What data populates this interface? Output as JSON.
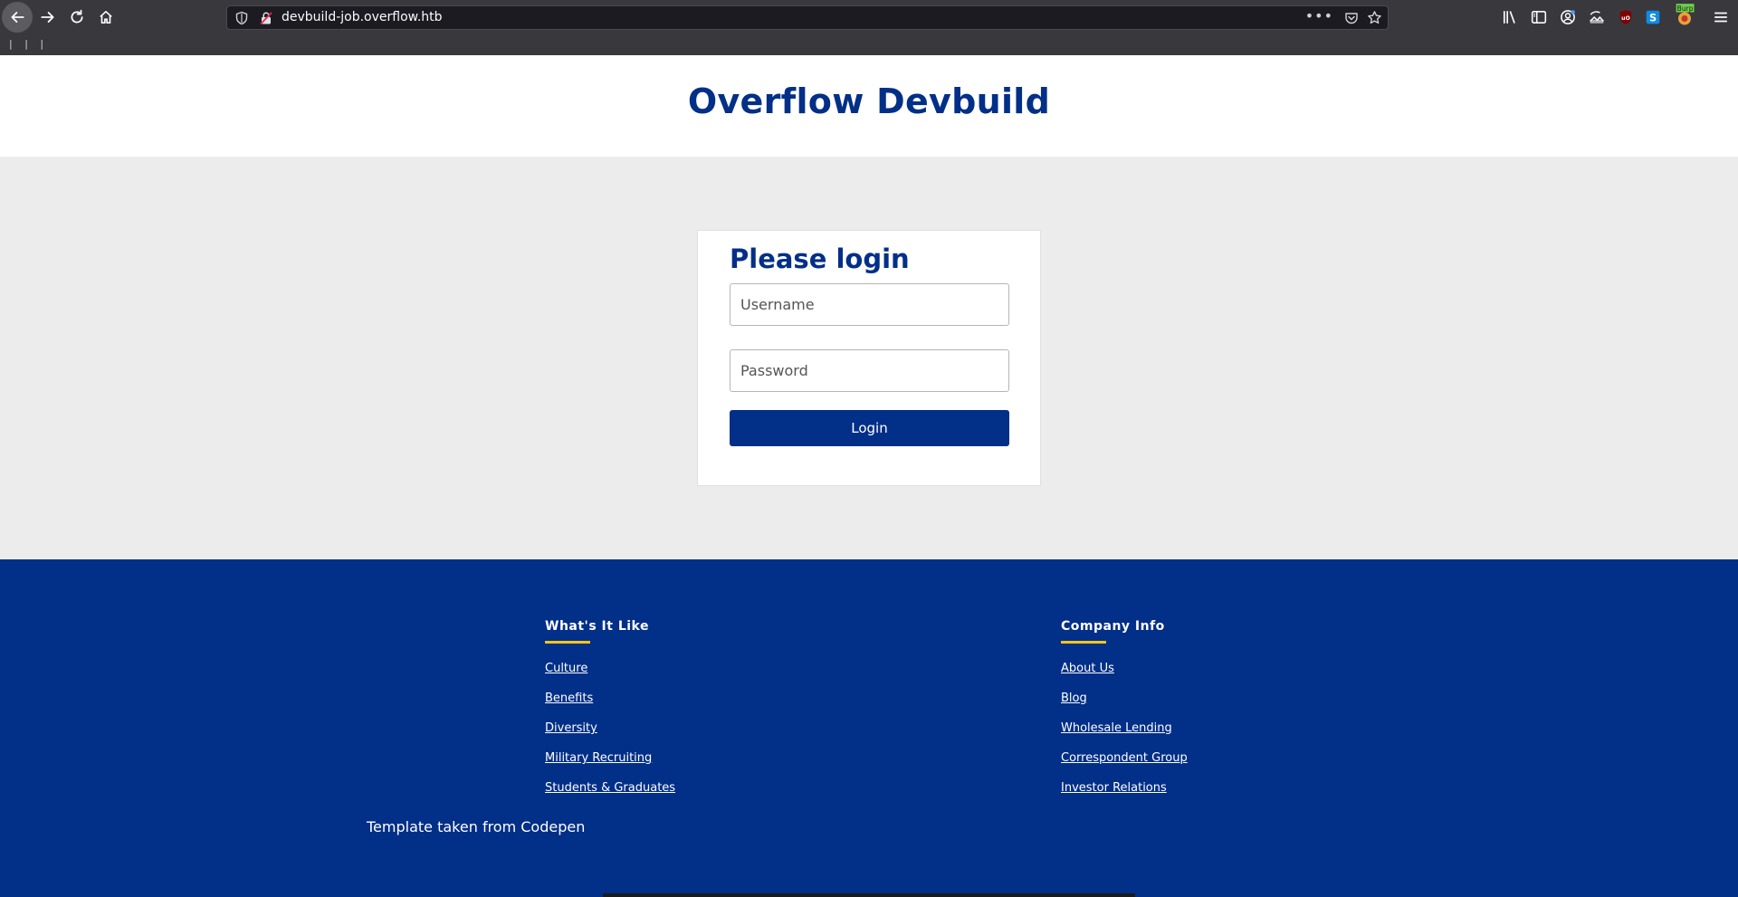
{
  "browser": {
    "url": "devbuild-job.overflow.htb",
    "more_label": "•••",
    "bookmarks_text": "| | |",
    "toolbar_icons": [
      "library-icon",
      "sidebar-icon",
      "account-icon",
      "screenshot-icon",
      "ublock-icon",
      "s-extension-icon",
      "burp-extension-icon",
      "menu-icon"
    ],
    "burp_badge": "Burp"
  },
  "header": {
    "title": "Overflow Devbuild"
  },
  "login": {
    "heading": "Please login",
    "username_placeholder": "Username",
    "username_value": "",
    "password_placeholder": "Password",
    "password_value": "",
    "submit_label": "Login"
  },
  "footer": {
    "columns": [
      {
        "heading": "What's It Like",
        "links": [
          "Culture",
          "Benefits",
          "Diversity",
          "Military Recruiting",
          "Students & Graduates"
        ]
      },
      {
        "heading": "Company Info",
        "links": [
          "About Us",
          "Blog",
          "Wholesale Lending",
          "Correspondent Group",
          "Investor Relations"
        ]
      }
    ],
    "credit": "Template taken from Codepen"
  },
  "colors": {
    "brand_blue": "#022f87",
    "accent_yellow": "#f5c518",
    "page_bg": "#ececec",
    "chrome_bg": "#38383d"
  }
}
